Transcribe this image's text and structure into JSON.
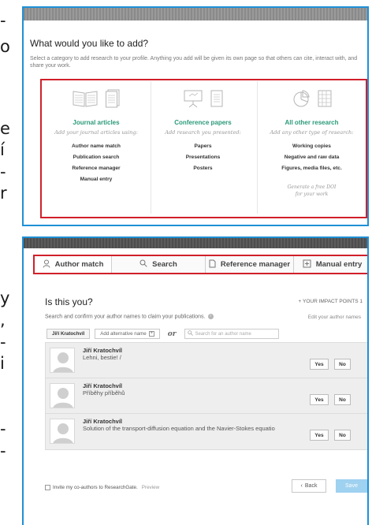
{
  "page_fragments": [
    "-",
    "o",
    "e",
    "í",
    "-",
    "r",
    "y",
    ",",
    "-",
    "i",
    "-",
    "-"
  ],
  "add_panel": {
    "title": "What would you like to add?",
    "description": "Select a category to add research to your profile. Anything you add will be given its own page so that others can cite, interact with, and share your work.",
    "categories": [
      {
        "title": "Journal articles",
        "subtitle": "Add your journal articles using:",
        "items": [
          "Author name match",
          "Publication search",
          "Reference manager",
          "Manual entry"
        ],
        "icons": [
          "open-book-icon",
          "stacked-docs-icon"
        ]
      },
      {
        "title": "Conference papers",
        "subtitle": "Add research you presented:",
        "items": [
          "Papers",
          "Presentations",
          "Posters"
        ],
        "icons": [
          "easel-icon",
          "document-icon"
        ]
      },
      {
        "title": "All other research",
        "subtitle": "Add any other type of research:",
        "items": [
          "Working copies",
          "Negative and raw data",
          "Figures, media files, etc."
        ],
        "note_lines": [
          "Generate a free DOI",
          "for your work"
        ],
        "icons": [
          "pie-chart-icon",
          "data-grid-icon"
        ]
      }
    ],
    "accent_color": "#2a9a78",
    "highlight_color": "#d0202a",
    "frame_color": "#1e90d6"
  },
  "match_panel": {
    "tabs": [
      {
        "label": "Author match",
        "icon": "person-icon"
      },
      {
        "label": "Search",
        "icon": "search-icon"
      },
      {
        "label": "Reference manager",
        "icon": "document-icon"
      },
      {
        "label": "Manual entry",
        "icon": "edit-doc-icon"
      }
    ],
    "heading": "Is this you?",
    "impact_points": "+ YOUR IMPACT POINTS 1",
    "subheading": "Search and confirm your author names to claim your publications.",
    "edit_names": "Edit your author names",
    "name_chip": "Jiří Kratochvíl",
    "add_alt_name": "Add alternative name",
    "or_text": "or",
    "search_placeholder": "Search for an author name",
    "results": [
      {
        "author": "Jiří Kratochvíl",
        "title": "Lehni, bestie! /",
        "yes": "Yes",
        "no": "No"
      },
      {
        "author": "Jiří Kratochvíl",
        "title": "Příběhy příběhů",
        "yes": "Yes",
        "no": "No"
      },
      {
        "author": "Jiří Kratochvíl",
        "title": "Solution of the transport-diffusion equation and the Navier-Stokes equatio",
        "yes": "Yes",
        "no": "No"
      }
    ],
    "invite_label": "Invite my co-authors to ResearchGate.",
    "invite_preview": "Preview",
    "back_label": "Back",
    "save_label": "Save",
    "save_color": "#9fd1f0"
  }
}
